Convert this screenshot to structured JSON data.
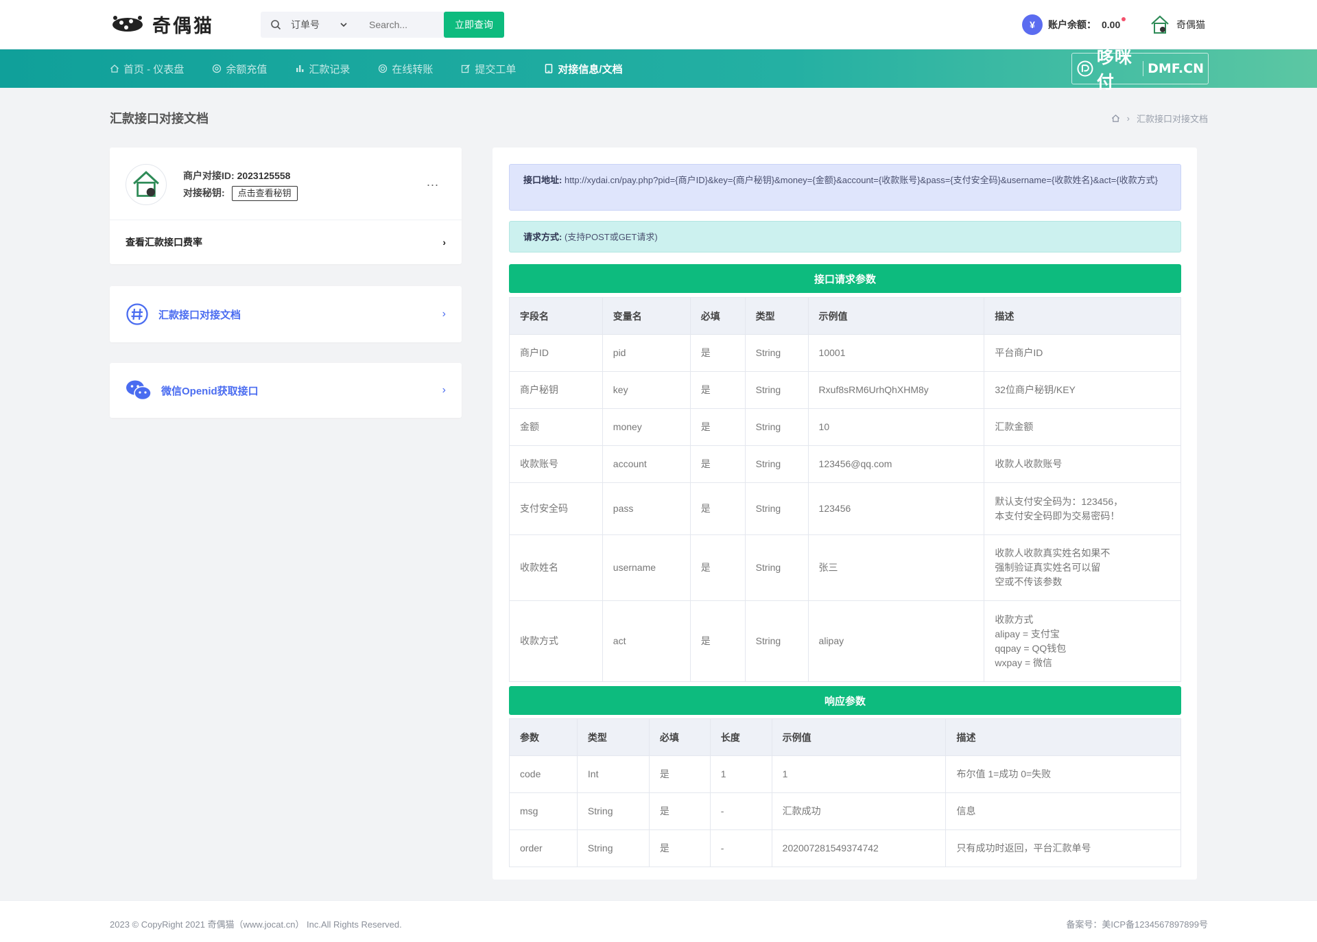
{
  "header": {
    "logo_text": "奇偶猫",
    "search": {
      "select_value": "订单号",
      "placeholder": "Search...",
      "button_label": "立即查询"
    },
    "balance": {
      "label": "账户余额：",
      "value": "0.00"
    },
    "user_name": "奇偶猫"
  },
  "nav": {
    "items": [
      {
        "label": "首页 - 仪表盘",
        "icon": "home-icon"
      },
      {
        "label": "余额充值",
        "icon": "target-icon"
      },
      {
        "label": "汇款记录",
        "icon": "bar-chart-icon"
      },
      {
        "label": "在线转账",
        "icon": "gear-icon"
      },
      {
        "label": "提交工单",
        "icon": "edit-icon"
      },
      {
        "label": "对接信息/文档",
        "icon": "tablet-icon",
        "active": true
      }
    ],
    "brand": {
      "name": "哆咪付",
      "domain": "DMF.CN"
    }
  },
  "page": {
    "title": "汇款接口对接文档",
    "breadcrumb": "汇款接口对接文档"
  },
  "sidebar": {
    "merchant": {
      "id_label": "商户对接ID:",
      "id_value": "2023125558",
      "key_label": "对接秘钥:",
      "key_button": "点击查看秘钥",
      "more": "...",
      "rate_link": "查看汇款接口费率"
    },
    "doc_link": "汇款接口对接文档",
    "wx_link": "微信Openid获取接口"
  },
  "main": {
    "api_url_label": "接口地址:",
    "api_url": "http://xydai.cn/pay.php?pid={商户ID}&key={商户秘钥}&money={金额}&account={收款账号}&pass={支付安全码}&username={收款姓名}&act={收款方式}",
    "method_label": "请求方式:",
    "method_value": "(支持POST或GET请求)",
    "request_title": "接口请求参数",
    "request_headers": [
      "字段名",
      "变量名",
      "必填",
      "类型",
      "示例值",
      "描述"
    ],
    "request_rows": [
      [
        "商户ID",
        "pid",
        "是",
        "String",
        "10001",
        "平台商户ID"
      ],
      [
        "商户秘钥",
        "key",
        "是",
        "String",
        "Rxuf8sRM6UrhQhXHM8y",
        "32位商户秘钥/KEY"
      ],
      [
        "金额",
        "money",
        "是",
        "String",
        "10",
        "汇款金额"
      ],
      [
        "收款账号",
        "account",
        "是",
        "String",
        "123456@qq.com",
        "收款人收款账号"
      ],
      [
        "支付安全码",
        "pass",
        "是",
        "String",
        "123456",
        "默认支付安全码为：123456，\n本支付安全码即为交易密码！"
      ],
      [
        "收款姓名",
        "username",
        "是",
        "String",
        "张三",
        "收款人收款真实姓名如果不\n强制验证真实姓名可以留\n空或不传该参数"
      ],
      [
        "收款方式",
        "act",
        "是",
        "String",
        "alipay",
        "收款方式\nalipay = 支付宝\nqqpay = QQ钱包\nwxpay = 微信"
      ]
    ],
    "response_title": "响应参数",
    "response_headers": [
      "参数",
      "类型",
      "必填",
      "长度",
      "示例值",
      "描述"
    ],
    "response_rows": [
      [
        "code",
        "Int",
        "是",
        "1",
        "1",
        "布尔值 1=成功 0=失败"
      ],
      [
        "msg",
        "String",
        "是",
        "-",
        "汇款成功",
        "信息"
      ],
      [
        "order",
        "String",
        "是",
        "-",
        "202007281549374742",
        "只有成功时返回，平台汇款单号"
      ]
    ]
  },
  "footer": {
    "copyright": "2023 © CopyRight 2021 奇偶猫（www.jocat.cn） Inc.All Rights Reserved.",
    "icp": "备案号：美ICP备1234567897899号"
  },
  "colors": {
    "accent_green": "#0dbb7e",
    "nav_teal": "#10a09a",
    "link_blue": "#4a6cf0",
    "balance_badge": "#5b6cf0"
  }
}
